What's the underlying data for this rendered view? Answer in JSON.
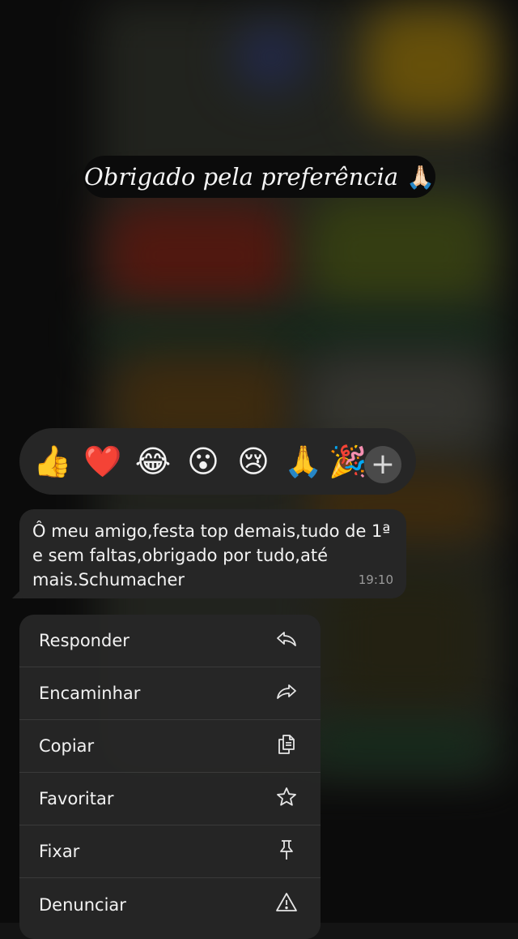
{
  "caption": {
    "text": "Obrigado pela preferência",
    "emoji": "🙏🏻"
  },
  "reactions": [
    "👍",
    "❤️",
    "😂",
    "😮",
    "😢",
    "🙏",
    "🎉"
  ],
  "reaction_more_label": "+",
  "message": {
    "text": "Ô meu amigo,festa top demais,tudo de 1ª e sem faltas,obrigado por tudo,até mais.Schumacher",
    "time": "19:10"
  },
  "menu": {
    "items": [
      {
        "label": "Responder",
        "icon": "reply-icon"
      },
      {
        "label": "Encaminhar",
        "icon": "forward-icon"
      },
      {
        "label": "Copiar",
        "icon": "copy-icon"
      },
      {
        "label": "Favoritar",
        "icon": "star-icon"
      },
      {
        "label": "Fixar",
        "icon": "pin-icon"
      },
      {
        "label": "Denunciar",
        "icon": "warning-icon"
      }
    ]
  },
  "colors": {
    "surface": "#262626",
    "background": "#141414",
    "text": "#f2f2f2",
    "meta": "#9a9a9a"
  }
}
